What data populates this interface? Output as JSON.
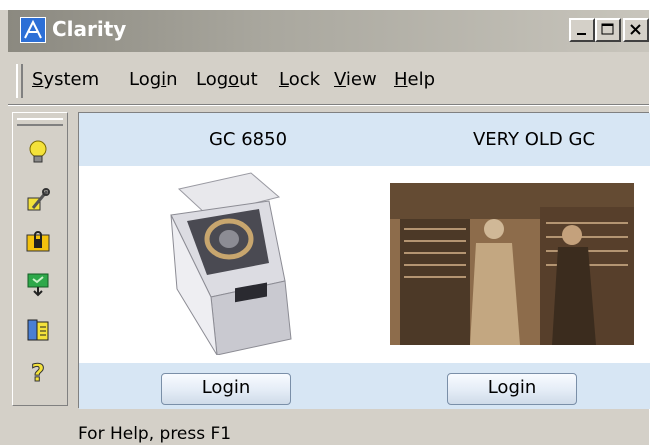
{
  "window": {
    "title": "Clarity",
    "app_icon": "clarity-logo-icon",
    "caption_buttons": [
      "minimize",
      "maximize",
      "close"
    ]
  },
  "menu": {
    "items": [
      {
        "label": "System",
        "mnemonic": "S"
      },
      {
        "label": "Login",
        "mnemonic": "i"
      },
      {
        "label": "Logout",
        "mnemonic": "o"
      },
      {
        "label": "Lock",
        "mnemonic": "L"
      },
      {
        "label": "View",
        "mnemonic": "V"
      },
      {
        "label": "Help",
        "mnemonic": "H"
      }
    ]
  },
  "toolbar": {
    "buttons": [
      {
        "icon": "lightbulb-icon"
      },
      {
        "icon": "configuration-icon"
      },
      {
        "icon": "lock-icon"
      },
      {
        "icon": "download-icon"
      },
      {
        "icon": "book-icon"
      },
      {
        "icon": "help-icon"
      }
    ]
  },
  "instruments": [
    {
      "name": "GC 6850",
      "image": "gc-6850-photo",
      "button_label": "Login"
    },
    {
      "name": "VERY OLD GC",
      "image": "very-old-gc-photo",
      "button_label": "Login"
    }
  ],
  "status": {
    "text": "For Help, press F1"
  },
  "colors": {
    "band": "#d7e6f4",
    "window_bg": "#d4d0c8",
    "title_gradient_start": "#8b8980",
    "title_gradient_end": "#c8c5bc"
  }
}
